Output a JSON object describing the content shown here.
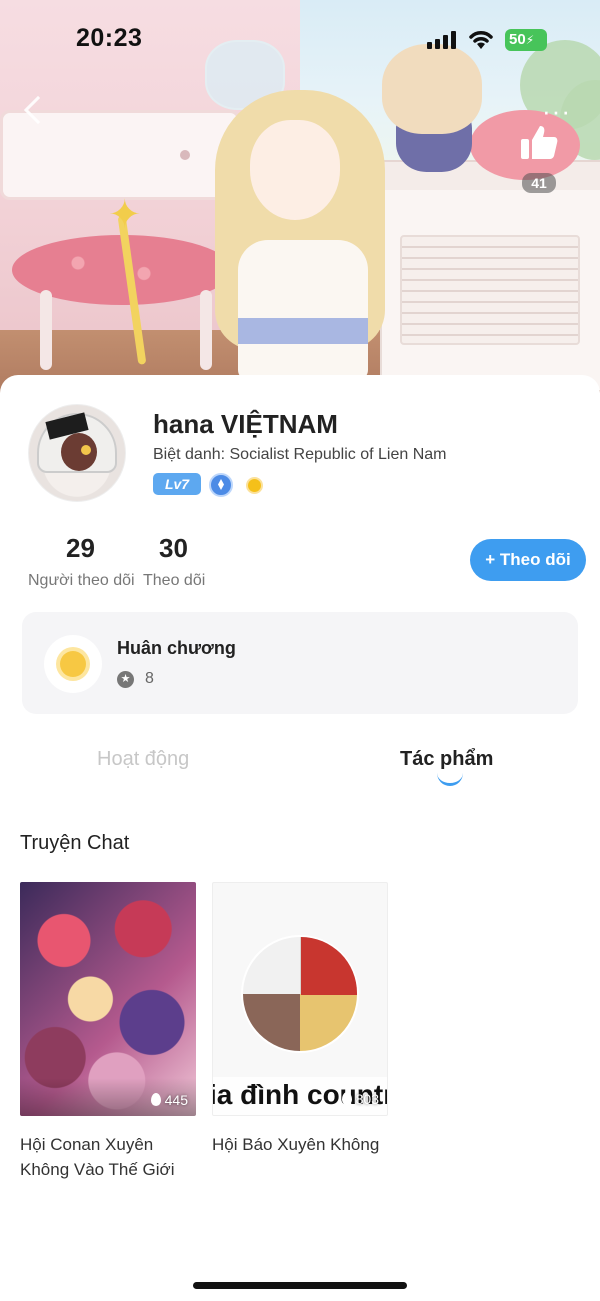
{
  "status_bar": {
    "time": "20:23",
    "battery": "50",
    "icons": [
      "signal-icon",
      "wifi-icon",
      "battery-icon"
    ]
  },
  "header": {
    "like_count": "41",
    "icons": [
      "back-icon",
      "more-icon",
      "thumbs-up-icon"
    ]
  },
  "profile": {
    "name": "hana VIỆTNAM",
    "nickname": "Biệt danh: Socialist Republic of Lien Nam",
    "level": "Lv7",
    "badges": [
      "verified-badge-icon",
      "coin-badge-icon"
    ]
  },
  "stats": {
    "followers": {
      "value": "29",
      "label": "Người theo dõi"
    },
    "following": {
      "value": "30",
      "label": "Theo dõi"
    }
  },
  "follow_button": {
    "label": "+ Theo dõi"
  },
  "medals": {
    "title": "Huân chương",
    "count": "8"
  },
  "tabs": [
    {
      "label": "Hoạt động",
      "active": false
    },
    {
      "label": "Tác phẩm",
      "active": true
    }
  ],
  "section": {
    "title": "Truyện Chat"
  },
  "works": [
    {
      "title": "Hội Conan Xuyên Không Vào Thế Giới",
      "views": "445"
    },
    {
      "title": "Hội Báo Xuyên Không",
      "views": "803",
      "cover_text": "ia đình countr"
    }
  ],
  "colors": {
    "accent": "#3e9df0",
    "level_badge": "#5da8f0",
    "battery": "#47c45a"
  }
}
